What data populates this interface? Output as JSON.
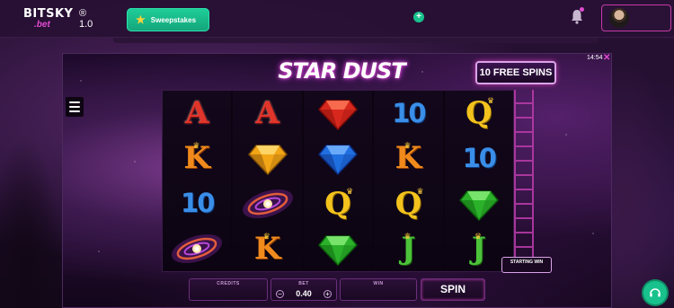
{
  "header": {
    "brand_main": "BITSKY",
    "brand_sub": ".bet",
    "brand_version": "® 1.0",
    "sweepstakes_label": "Sweepstakes"
  },
  "game": {
    "title": "STAR DUST",
    "free_spins": "10 FREE SPINS",
    "clock": "14:54",
    "starting_win_label": "STARTING WIN",
    "reels": [
      [
        {
          "type": "letter",
          "text": "A",
          "color": "red"
        },
        {
          "type": "letter",
          "text": "K",
          "color": "orange",
          "crown": true
        },
        {
          "type": "ten",
          "text": "10",
          "color": "blue"
        },
        {
          "type": "galaxy"
        }
      ],
      [
        {
          "type": "letter",
          "text": "A",
          "color": "red"
        },
        {
          "type": "gem-yellow"
        },
        {
          "type": "galaxy"
        },
        {
          "type": "letter",
          "text": "K",
          "color": "orange",
          "crown": true
        }
      ],
      [
        {
          "type": "gem-red"
        },
        {
          "type": "gem-blue"
        },
        {
          "type": "letter",
          "text": "Q",
          "color": "yellow",
          "crown": true
        },
        {
          "type": "gem-green"
        }
      ],
      [
        {
          "type": "ten",
          "text": "10",
          "color": "blue"
        },
        {
          "type": "letter",
          "text": "K",
          "color": "orange",
          "crown": true
        },
        {
          "type": "letter",
          "text": "Q",
          "color": "yellow",
          "crown": true
        },
        {
          "type": "letter",
          "text": "J",
          "color": "green",
          "crown": true
        }
      ],
      [
        {
          "type": "letter",
          "text": "Q",
          "color": "yellow",
          "crown": true
        },
        {
          "type": "ten",
          "text": "10",
          "color": "blue"
        },
        {
          "type": "gem-green"
        },
        {
          "type": "letter",
          "text": "J",
          "color": "green",
          "crown": true
        }
      ]
    ]
  },
  "controls": {
    "credits_label": "CREDITS",
    "bet_label": "BET",
    "bet_value": "0.40",
    "bet_minus": "−",
    "bet_plus": "+",
    "win_label": "WIN",
    "spin_label": "SPIN"
  },
  "colors": {
    "accent": "#e14bd0",
    "green": "#19c28d",
    "frame_border": "#6a2f7c"
  }
}
